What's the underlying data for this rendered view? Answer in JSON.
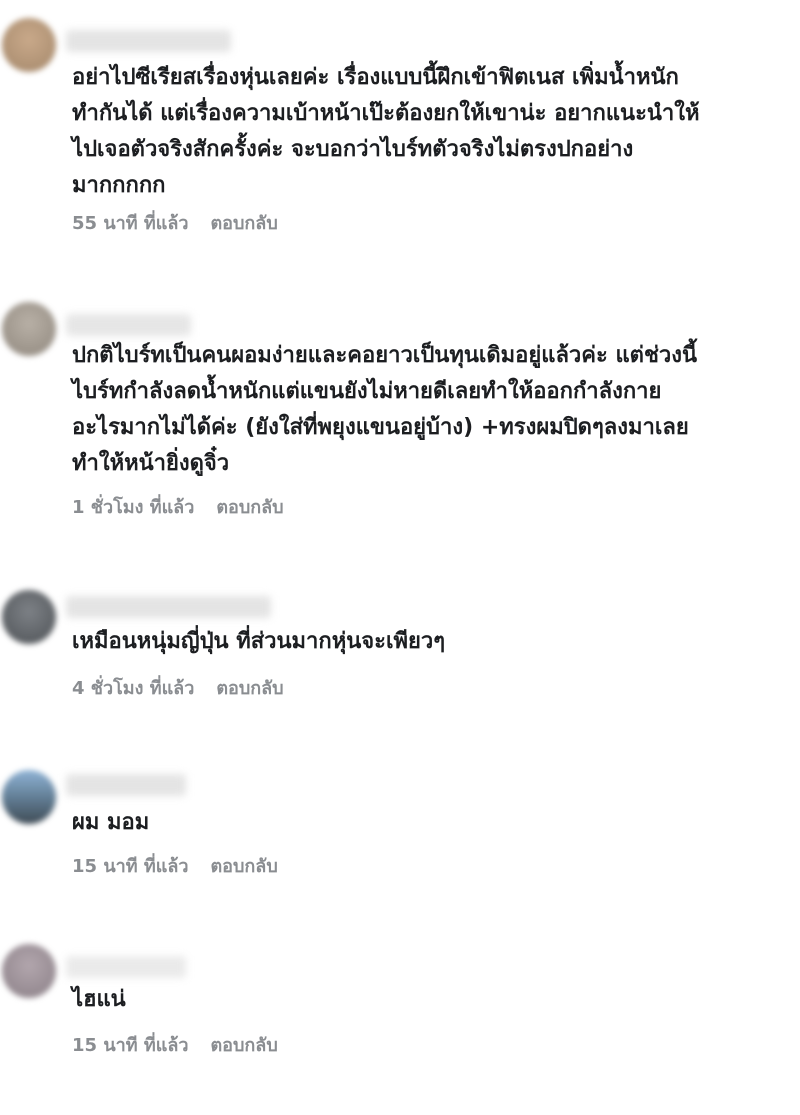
{
  "comments": [
    {
      "text": "อย่าไปซีเรียสเรื่องหุ่นเลยค่ะ เรื่องแบบนี้ฝึกเข้าฟิตเนส เพิ่มน้ำหนัก\nทำกันได้ แต่เรื่องความเบ้าหน้าเป๊ะต้องยกให้เขาน่ะ อยากแนะนำให้\nไปเจอตัวจริงสักครั้งค่ะ จะบอกว่าไบร์ทตัวจริงไม่ตรงปกอย่าง\nมากกกกก",
      "time": "55 นาที ที่แล้ว",
      "reply": "ตอบกลับ",
      "avatar_color": "#b79a7c"
    },
    {
      "text": "ปกติไบร์ทเป็นคนผอมง่ายและคอยาวเป็นทุนเดิมอยู่แล้วค่ะ แต่ช่วงนี้\nไบร์ทกำลังลดน้ำหนักแต่แขนยังไม่หายดีเลยทำให้ออกกำลังกาย\nอะไรมากไม่ได้ค่ะ (ยังใส่ที่พยุงแขนอยู่บ้าง) +ทรงผมปิดๆลงมาเลย\nทำให้หน้ายิ่งดูจิ๋ว",
      "time": "1 ชั่วโมง ที่แล้ว",
      "reply": "ตอบกลับ",
      "avatar_color": "#a59d93"
    },
    {
      "text": "เหมือนหนุ่มญี่ปุ่น ที่ส่วนมากหุ่นจะเพียวๆ",
      "time": "4 ชั่วโมง ที่แล้ว",
      "reply": "ตอบกลับ",
      "avatar_color": "#6b6f74"
    },
    {
      "text": "ผม มอม",
      "time": "15 นาที ที่แล้ว",
      "reply": "ตอบกลับ",
      "avatar_color": "#5b7388"
    },
    {
      "text": "ไฮแน่",
      "time": "15 นาที ที่แล้ว",
      "reply": "ตอบกลับ",
      "avatar_color": "#9a8f96"
    }
  ]
}
